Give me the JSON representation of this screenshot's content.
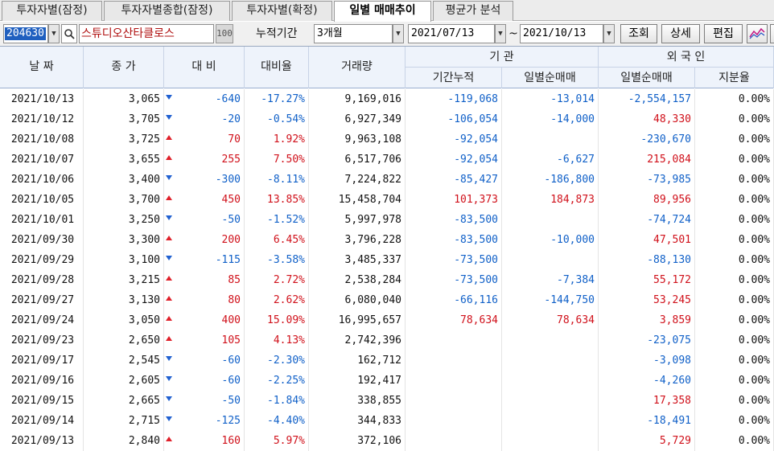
{
  "tabs": [
    {
      "label": "투자자별(잠정)",
      "active": false
    },
    {
      "label": "투자자별종합(잠정)",
      "active": false
    },
    {
      "label": "투자자별(확정)",
      "active": false
    },
    {
      "label": "일별 매매추이",
      "active": true
    },
    {
      "label": "평균가 분석",
      "active": false
    }
  ],
  "toolbar": {
    "code": "204630",
    "name": "스튜디오산타클로스",
    "badge": "100",
    "period_label": "누적기간",
    "period_value": "3개월",
    "date_from": "2021/07/13",
    "date_sep": "~",
    "date_to": "2021/10/13",
    "query_label": "조회",
    "detail_label": "상세",
    "edit_label": "편집"
  },
  "header": {
    "date": "날 짜",
    "close": "종 가",
    "change": "대 비",
    "rate": "대비율",
    "volume": "거래량",
    "inst_group": "기  관",
    "inst_cum": "기간누적",
    "inst_daily": "일별순매매",
    "foreign_group": "외 국 인",
    "foreign_daily": "일별순매매",
    "foreign_share": "지분율"
  },
  "rows": [
    {
      "date": "2021/10/13",
      "close": "3,065",
      "dir": "down",
      "change": "-640",
      "rate": "-17.27%",
      "volume": "9,169,016",
      "inst_cum": "-119,068",
      "inst_daily": "-13,014",
      "foreign_daily": "-2,554,157",
      "share": "0.00%"
    },
    {
      "date": "2021/10/12",
      "close": "3,705",
      "dir": "down",
      "change": "-20",
      "rate": "-0.54%",
      "volume": "6,927,349",
      "inst_cum": "-106,054",
      "inst_daily": "-14,000",
      "foreign_daily": "48,330",
      "share": "0.00%"
    },
    {
      "date": "2021/10/08",
      "close": "3,725",
      "dir": "up",
      "change": "70",
      "rate": "1.92%",
      "volume": "9,963,108",
      "inst_cum": "-92,054",
      "inst_daily": "",
      "foreign_daily": "-230,670",
      "share": "0.00%"
    },
    {
      "date": "2021/10/07",
      "close": "3,655",
      "dir": "up",
      "change": "255",
      "rate": "7.50%",
      "volume": "6,517,706",
      "inst_cum": "-92,054",
      "inst_daily": "-6,627",
      "foreign_daily": "215,084",
      "share": "0.00%"
    },
    {
      "date": "2021/10/06",
      "close": "3,400",
      "dir": "down",
      "change": "-300",
      "rate": "-8.11%",
      "volume": "7,224,822",
      "inst_cum": "-85,427",
      "inst_daily": "-186,800",
      "foreign_daily": "-73,985",
      "share": "0.00%"
    },
    {
      "date": "2021/10/05",
      "close": "3,700",
      "dir": "up",
      "change": "450",
      "rate": "13.85%",
      "volume": "15,458,704",
      "inst_cum": "101,373",
      "inst_daily": "184,873",
      "foreign_daily": "89,956",
      "share": "0.00%"
    },
    {
      "date": "2021/10/01",
      "close": "3,250",
      "dir": "down",
      "change": "-50",
      "rate": "-1.52%",
      "volume": "5,997,978",
      "inst_cum": "-83,500",
      "inst_daily": "",
      "foreign_daily": "-74,724",
      "share": "0.00%"
    },
    {
      "date": "2021/09/30",
      "close": "3,300",
      "dir": "up",
      "change": "200",
      "rate": "6.45%",
      "volume": "3,796,228",
      "inst_cum": "-83,500",
      "inst_daily": "-10,000",
      "foreign_daily": "47,501",
      "share": "0.00%"
    },
    {
      "date": "2021/09/29",
      "close": "3,100",
      "dir": "down",
      "change": "-115",
      "rate": "-3.58%",
      "volume": "3,485,337",
      "inst_cum": "-73,500",
      "inst_daily": "",
      "foreign_daily": "-88,130",
      "share": "0.00%"
    },
    {
      "date": "2021/09/28",
      "close": "3,215",
      "dir": "up",
      "change": "85",
      "rate": "2.72%",
      "volume": "2,538,284",
      "inst_cum": "-73,500",
      "inst_daily": "-7,384",
      "foreign_daily": "55,172",
      "share": "0.00%"
    },
    {
      "date": "2021/09/27",
      "close": "3,130",
      "dir": "up",
      "change": "80",
      "rate": "2.62%",
      "volume": "6,080,040",
      "inst_cum": "-66,116",
      "inst_daily": "-144,750",
      "foreign_daily": "53,245",
      "share": "0.00%"
    },
    {
      "date": "2021/09/24",
      "close": "3,050",
      "dir": "up",
      "change": "400",
      "rate": "15.09%",
      "volume": "16,995,657",
      "inst_cum": "78,634",
      "inst_daily": "78,634",
      "foreign_daily": "3,859",
      "share": "0.00%"
    },
    {
      "date": "2021/09/23",
      "close": "2,650",
      "dir": "up",
      "change": "105",
      "rate": "4.13%",
      "volume": "2,742,396",
      "inst_cum": "",
      "inst_daily": "",
      "foreign_daily": "-23,075",
      "share": "0.00%"
    },
    {
      "date": "2021/09/17",
      "close": "2,545",
      "dir": "down",
      "change": "-60",
      "rate": "-2.30%",
      "volume": "162,712",
      "inst_cum": "",
      "inst_daily": "",
      "foreign_daily": "-3,098",
      "share": "0.00%"
    },
    {
      "date": "2021/09/16",
      "close": "2,605",
      "dir": "down",
      "change": "-60",
      "rate": "-2.25%",
      "volume": "192,417",
      "inst_cum": "",
      "inst_daily": "",
      "foreign_daily": "-4,260",
      "share": "0.00%"
    },
    {
      "date": "2021/09/15",
      "close": "2,665",
      "dir": "down",
      "change": "-50",
      "rate": "-1.84%",
      "volume": "338,855",
      "inst_cum": "",
      "inst_daily": "",
      "foreign_daily": "17,358",
      "share": "0.00%"
    },
    {
      "date": "2021/09/14",
      "close": "2,715",
      "dir": "down",
      "change": "-125",
      "rate": "-4.40%",
      "volume": "344,833",
      "inst_cum": "",
      "inst_daily": "",
      "foreign_daily": "-18,491",
      "share": "0.00%"
    },
    {
      "date": "2021/09/13",
      "close": "2,840",
      "dir": "up",
      "change": "160",
      "rate": "5.97%",
      "volume": "372,106",
      "inst_cum": "",
      "inst_daily": "",
      "foreign_daily": "5,729",
      "share": "0.00%"
    }
  ]
}
